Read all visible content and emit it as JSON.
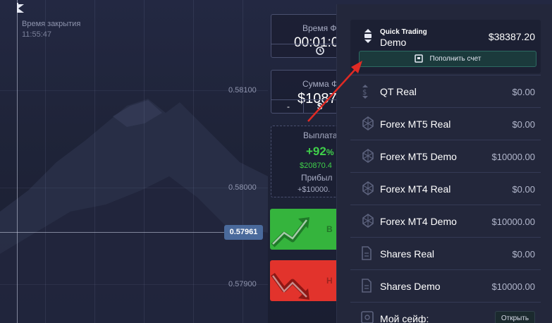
{
  "chart": {
    "close_label": "Время закрытия",
    "close_time": "11:55:47",
    "price_ticks": [
      "0.58100",
      "0.58000",
      "0.57900"
    ],
    "current_price": "0.57961"
  },
  "trade": {
    "time_label": "Время Ф",
    "time_value": "00:01:0",
    "amount_label": "Сумма Ф",
    "amount_value": "$1087",
    "minus_label": "-",
    "plus_label": "$",
    "payout_label": "Выплата",
    "payout_percent": "+92",
    "payout_percent_sign": "%",
    "payout_amount": "$20870.4",
    "profit_label": "Прибыл",
    "profit_value": "+$10000.",
    "up_label": "В",
    "down_label": "Н"
  },
  "accounts": {
    "header": {
      "subtitle": "Quick Trading",
      "name": "Demo",
      "balance": "$38387.20",
      "topup_label": "Пополнить счет"
    },
    "items": [
      {
        "name": "QT Real",
        "balance": "$0.00",
        "icon": "dollar-arrows-icon"
      },
      {
        "name": "Forex MT5 Real",
        "balance": "$0.00",
        "icon": "metatrader-icon"
      },
      {
        "name": "Forex MT5 Demo",
        "balance": "$10000.00",
        "icon": "metatrader-icon"
      },
      {
        "name": "Forex MT4 Real",
        "balance": "$0.00",
        "icon": "metatrader-icon"
      },
      {
        "name": "Forex MT4 Demo",
        "balance": "$10000.00",
        "icon": "metatrader-icon"
      },
      {
        "name": "Shares Real",
        "balance": "$0.00",
        "icon": "document-icon"
      },
      {
        "name": "Shares Demo",
        "balance": "$10000.00",
        "icon": "document-icon"
      }
    ],
    "safe": {
      "name": "Мой сейф:",
      "button": "Открыть"
    }
  },
  "colors": {
    "up": "#35b43d",
    "down": "#e2332c",
    "payout_green": "#3fcf4a",
    "annotation_arrow": "#e02a24",
    "topup_border": "#2d6a62"
  }
}
